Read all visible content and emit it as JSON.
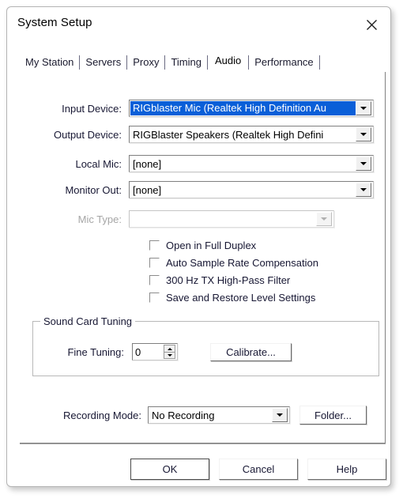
{
  "window": {
    "title": "System Setup",
    "close_icon": "close-x-icon"
  },
  "tabs": [
    {
      "label": "My Station",
      "selected": false
    },
    {
      "label": "Servers",
      "selected": false
    },
    {
      "label": "Proxy",
      "selected": false
    },
    {
      "label": "Timing",
      "selected": false
    },
    {
      "label": "Audio",
      "selected": true
    },
    {
      "label": "Performance",
      "selected": false
    }
  ],
  "fields": {
    "input_device": {
      "label": "Input Device:",
      "value": "RIGblaster Mic (Realtek High Definition Au",
      "highlighted": true,
      "disabled": false
    },
    "output_device": {
      "label": "Output Device:",
      "value": "RIGBlaster Speakers  (Realtek High Defini",
      "highlighted": false,
      "disabled": false
    },
    "local_mic": {
      "label": "Local Mic:",
      "value": "[none]",
      "highlighted": false,
      "disabled": false
    },
    "monitor_out": {
      "label": "Monitor Out:",
      "value": "[none]",
      "highlighted": false,
      "disabled": false
    },
    "mic_type": {
      "label": "Mic Type:",
      "value": "",
      "highlighted": false,
      "disabled": true
    },
    "recording_mode": {
      "label": "Recording Mode:",
      "value": "No Recording",
      "highlighted": false,
      "disabled": false
    }
  },
  "checkboxes": [
    {
      "label": "Open in Full Duplex",
      "checked": false
    },
    {
      "label": "Auto Sample Rate Compensation",
      "checked": false
    },
    {
      "label": "300 Hz TX High-Pass Filter",
      "checked": false
    },
    {
      "label": "Save and Restore Level Settings",
      "checked": false
    }
  ],
  "sound_card_tuning": {
    "title": "Sound Card Tuning",
    "fine_tuning_label": "Fine Tuning:",
    "fine_tuning_value": "0",
    "calibrate_label": "Calibrate..."
  },
  "folder_button": {
    "label": "Folder..."
  },
  "footer_buttons": [
    {
      "label": "OK",
      "default": true
    },
    {
      "label": "Cancel",
      "default": false
    },
    {
      "label": "Help",
      "default": false
    }
  ],
  "colors": {
    "selection_blue": "#0a5fd8",
    "dialog_border": "#b4b4b4",
    "text": "#171733",
    "disabled_text": "#a6a6a6"
  }
}
